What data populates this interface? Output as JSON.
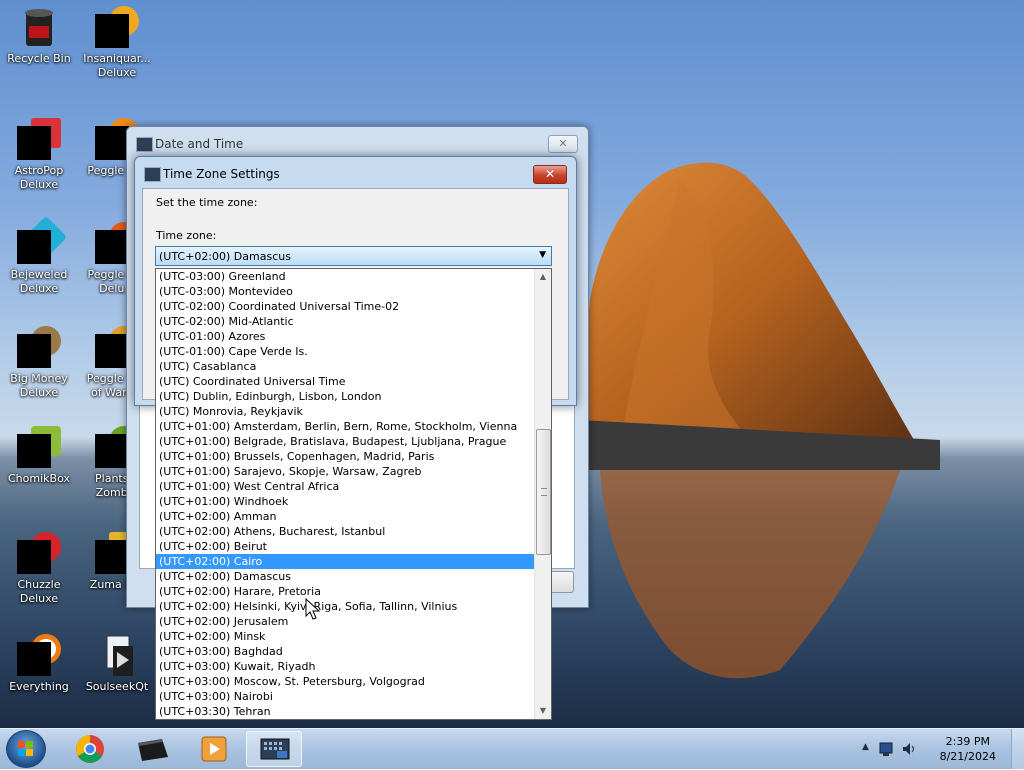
{
  "desktop": {
    "icons": [
      {
        "label": "Recycle Bin",
        "icon": "recycle-bin-icon"
      },
      {
        "label": "Insaniquar...\nDeluxe",
        "icon": "insaniquarium-icon"
      },
      {
        "label": "AstroPop\nDeluxe",
        "icon": "astropop-icon"
      },
      {
        "label": "Peggle D...",
        "icon": "peggle-icon"
      },
      {
        "label": "Bejeweled\nDeluxe",
        "icon": "bejeweled-icon"
      },
      {
        "label": "Peggle N...\nDelu...",
        "icon": "peggle-nights-icon"
      },
      {
        "label": "Big Money\nDeluxe",
        "icon": "big-money-icon"
      },
      {
        "label": "Peggle W...\nof Warc...",
        "icon": "peggle-wow-icon"
      },
      {
        "label": "ChomikBox",
        "icon": "chomikbox-icon"
      },
      {
        "label": "Plants...\nZomb...",
        "icon": "plants-vs-zombies-icon"
      },
      {
        "label": "Chuzzle\nDeluxe",
        "icon": "chuzzle-icon"
      },
      {
        "label": "Zuma D...",
        "icon": "zuma-icon"
      },
      {
        "label": "Everything",
        "icon": "everything-search-icon"
      },
      {
        "label": "SoulseekQt",
        "icon": "soulseek-icon"
      }
    ]
  },
  "date_time_window": {
    "title": "Date and Time",
    "close_glyph": "✕"
  },
  "tz_dialog": {
    "title": "Time Zone Settings",
    "close_glyph": "✕",
    "set_label": "Set the time zone:",
    "tz_label": "Time zone:",
    "selected_value": "(UTC+02:00) Damascus",
    "highlighted_item": "(UTC+02:00) Cairo",
    "options": [
      "(UTC-03:00) Greenland",
      "(UTC-03:00) Montevideo",
      "(UTC-02:00) Coordinated Universal Time-02",
      "(UTC-02:00) Mid-Atlantic",
      "(UTC-01:00) Azores",
      "(UTC-01:00) Cape Verde Is.",
      "(UTC) Casablanca",
      "(UTC) Coordinated Universal Time",
      "(UTC) Dublin, Edinburgh, Lisbon, London",
      "(UTC) Monrovia, Reykjavik",
      "(UTC+01:00) Amsterdam, Berlin, Bern, Rome, Stockholm, Vienna",
      "(UTC+01:00) Belgrade, Bratislava, Budapest, Ljubljana, Prague",
      "(UTC+01:00) Brussels, Copenhagen, Madrid, Paris",
      "(UTC+01:00) Sarajevo, Skopje, Warsaw, Zagreb",
      "(UTC+01:00) West Central Africa",
      "(UTC+01:00) Windhoek",
      "(UTC+02:00) Amman",
      "(UTC+02:00) Athens, Bucharest, Istanbul",
      "(UTC+02:00) Beirut",
      "(UTC+02:00) Cairo",
      "(UTC+02:00) Damascus",
      "(UTC+02:00) Harare, Pretoria",
      "(UTC+02:00) Helsinki, Kyiv, Riga, Sofia, Tallinn, Vilnius",
      "(UTC+02:00) Jerusalem",
      "(UTC+02:00) Minsk",
      "(UTC+03:00) Baghdad",
      "(UTC+03:00) Kuwait, Riyadh",
      "(UTC+03:00) Moscow, St. Petersburg, Volgograd",
      "(UTC+03:00) Nairobi",
      "(UTC+03:30) Tehran"
    ]
  },
  "taskbar": {
    "apps": [
      "start-orb-icon",
      "chrome-icon",
      "file-manager-icon",
      "media-player-icon",
      "date-time-app-icon"
    ],
    "clock_time": "2:39 PM",
    "clock_date": "8/21/2024"
  },
  "colors": {
    "selection": "#3399ff",
    "close_red": "#c7432c",
    "taskbar": "#a9c3e0"
  }
}
